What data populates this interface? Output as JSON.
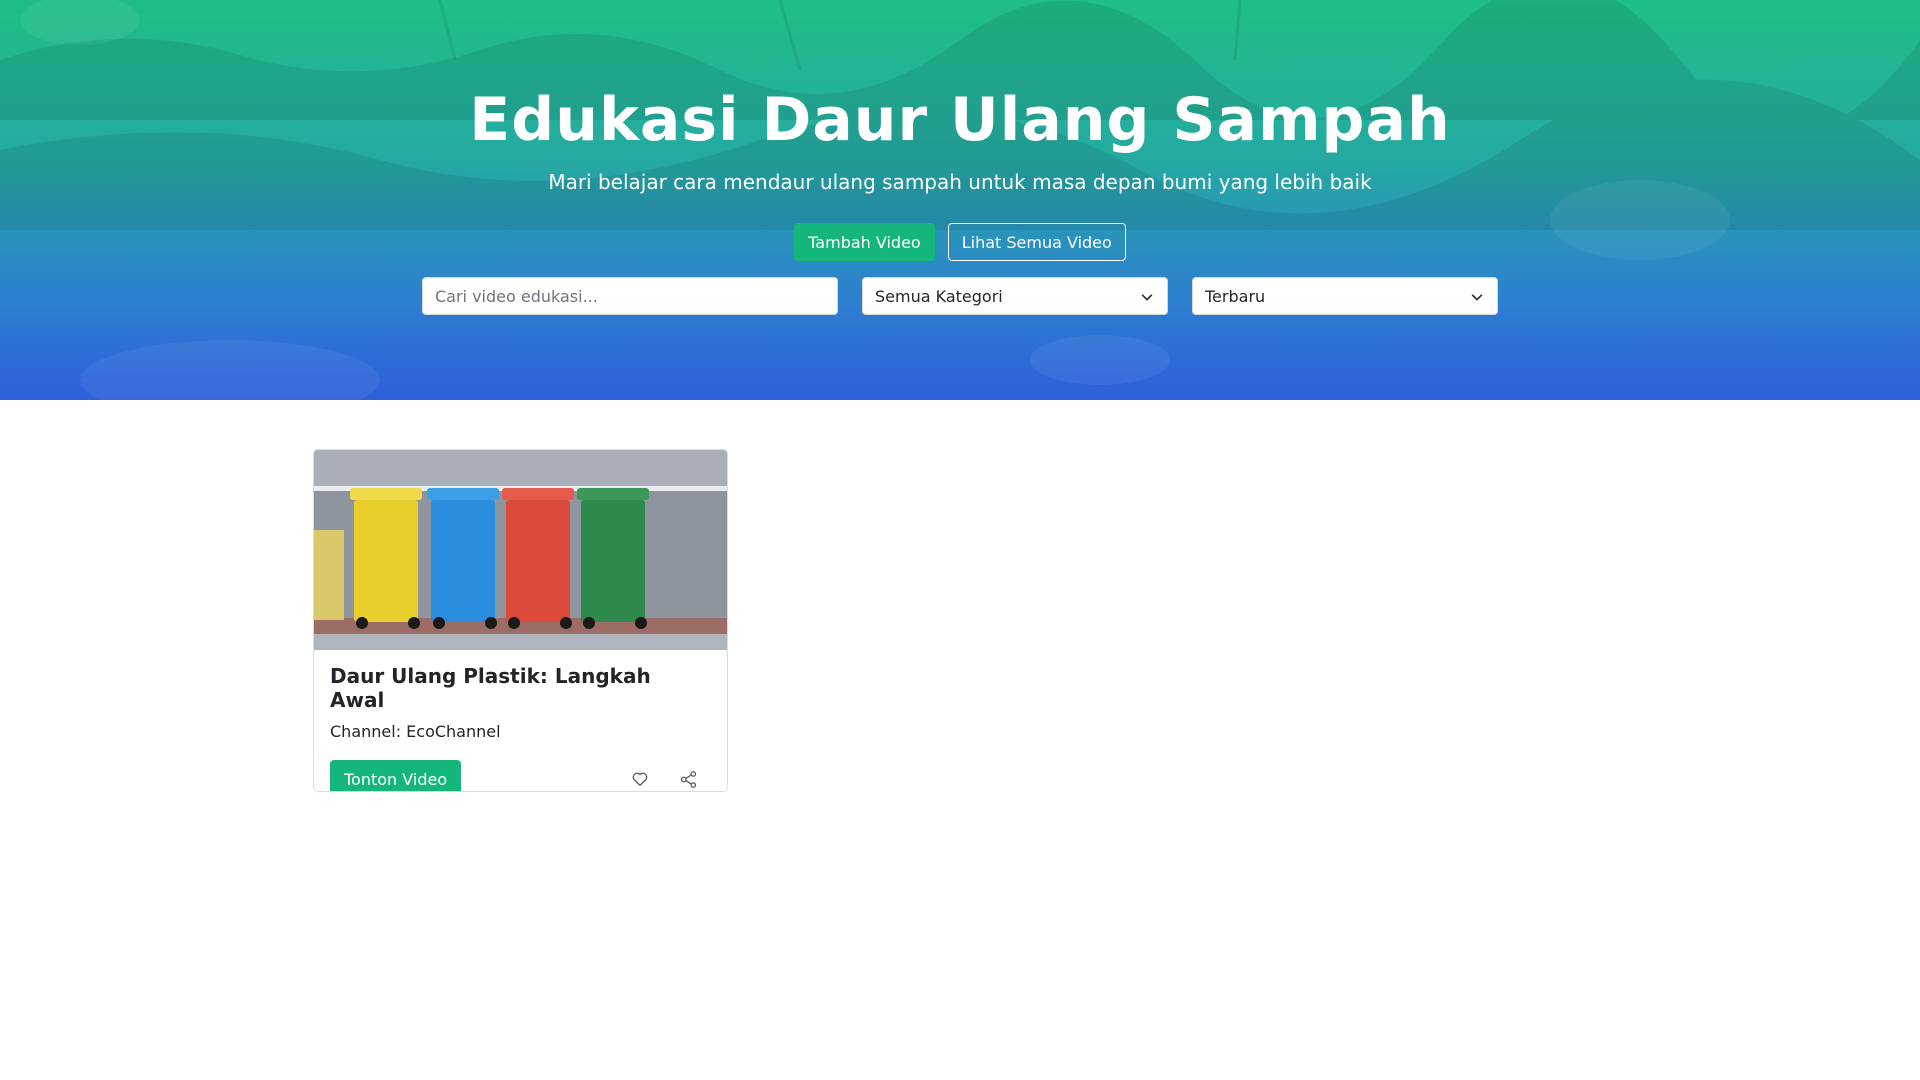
{
  "hero": {
    "title": "Edukasi Daur Ulang Sampah",
    "subtitle": "Mari belajar cara mendaur ulang sampah untuk masa depan bumi yang lebih baik",
    "add_button": "Tambah Video",
    "view_all_button": "Lihat Semua Video"
  },
  "filters": {
    "search_placeholder": "Cari video edukasi...",
    "search_value": "",
    "category_selected": "Semua Kategori",
    "sort_selected": "Terbaru"
  },
  "colors": {
    "brand_green": "#14b779",
    "gradient_top": "#1fbe86",
    "gradient_bottom": "#2e5fdc"
  },
  "videos": [
    {
      "title": "Daur Ulang Plastik: Langkah Awal",
      "channel": "Channel: EcoChannel",
      "watch_button": "Tonton Video",
      "bin_colors": [
        "#e8cf2c",
        "#2a8ddd",
        "#dc4a3b",
        "#2e8a4b"
      ],
      "like_icon": "heart-icon",
      "share_icon": "share-icon"
    }
  ]
}
